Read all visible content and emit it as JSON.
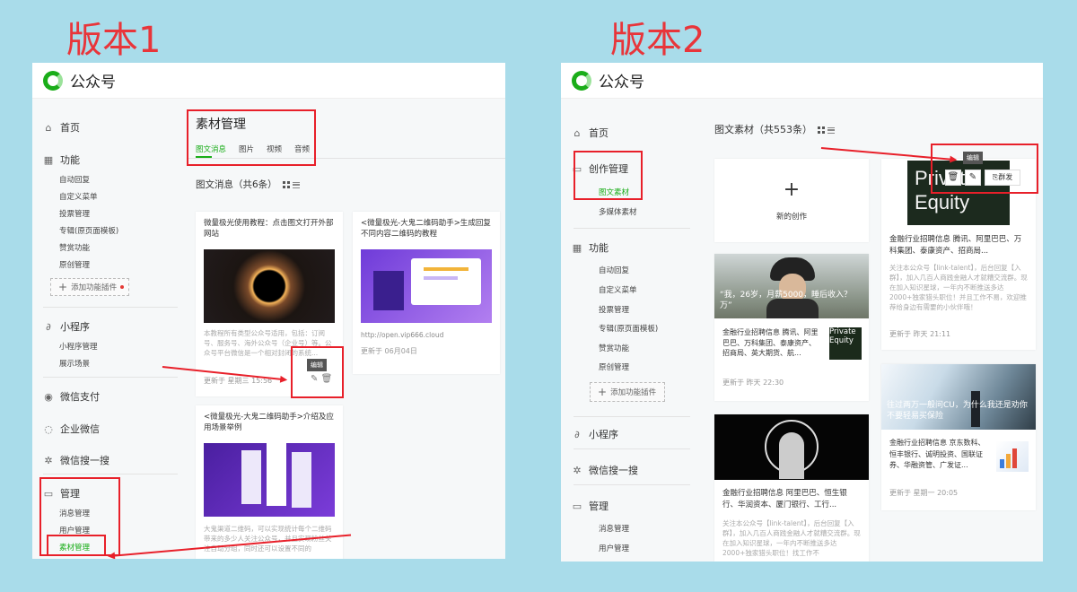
{
  "labels": {
    "v1": "版本1",
    "v2": "版本2"
  },
  "colors": {
    "accent": "#1aad19",
    "highlight": "#e8202a",
    "page_bg": "#a9dcea"
  },
  "v1": {
    "brand": "公众号",
    "nav": {
      "home": "首页",
      "features": "功能",
      "auto_reply": "自动回复",
      "custom_menu": "自定义菜单",
      "vote": "投票管理",
      "special": "专辑(原页面模板)",
      "reward": "赞赏功能",
      "original": "原创管理",
      "add_plugin": "添加功能插件",
      "mini": "小程序",
      "mini_manage": "小程序管理",
      "showcase": "展示场景",
      "pay": "微信支付",
      "work": "企业微信",
      "search": "微信搜一搜",
      "manage": "管理",
      "msg": "消息管理",
      "user": "用户管理",
      "material": "素材管理"
    },
    "header": {
      "title": "素材管理",
      "tabs": [
        "图文消息",
        "图片",
        "视频",
        "音频"
      ]
    },
    "count": "图文消息（共6条）",
    "cards": [
      {
        "title": "微量极光使用教程：点击图文打开外部网站",
        "desc": "本教程所有类型公众号适用，包括：订阅号、服务号、海外公众号（企业号）等。公众号平台微信是一个相对封闭的系统...",
        "updated": "更新于 星期三 15:56"
      },
      {
        "title": "<微量极光-大鬼二维码助手>生成回复不同内容二维码的教程",
        "url": "http://open.vip666.cloud",
        "updated": "更新于 06月04日"
      },
      {
        "title": "<微量极光-大鬼二维码助手>介绍及应用场景举例",
        "desc": "大鬼渠道二维码，可以实现统计每个二维码带来的多少人关注公众号，并且实现粉丝关注自动分组，同时还可以设置不同的"
      }
    ],
    "tooltip": "编辑",
    "icons": [
      "edit-icon",
      "delete-icon"
    ]
  },
  "v2": {
    "brand": "公众号",
    "nav": {
      "home": "首页",
      "create": "创作管理",
      "article": "图文素材",
      "media": "多媒体素材",
      "features": "功能",
      "auto_reply": "自动回复",
      "custom_menu": "自定义菜单",
      "vote": "投票管理",
      "special": "专辑(原页面模板)",
      "reward": "赞赏功能",
      "original": "原创管理",
      "add_plugin": "添加功能插件",
      "mini": "小程序",
      "search": "微信搜一搜",
      "manage": "管理",
      "msg": "消息管理",
      "user": "用户管理"
    },
    "count": "图文素材（共553条）",
    "new_create": "新的创作",
    "tooltip": "编辑",
    "publish": "群发",
    "cards": [
      {
        "overlay": "“我，26岁，月薪5000，睡后收入？万”",
        "sub": "金融行业招聘信息 腾讯、阿里巴巴、万科集团、泰康资产、招商局、英大期货、航...",
        "updated": "更新于 昨天 22:30"
      },
      {
        "title": "金融行业招聘信息 阿里巴巴、恒生银行、华润资本、厦门银行、工行...",
        "desc": "关注本公众号【link-talent】，后台回复【入群】，加入几百人商践金融人才就糟交流群。现在加入知识星球，一年内不断推送多达2000+独家猎头职位！找工作不"
      },
      {
        "img_text": "Private Equity",
        "title": "金融行业招聘信息 腾讯、阿里巴巴、万科集团、泰康资产、招商局...",
        "desc": "关注本公众号【link-talent】，后台回复【入群】，加入几百人商践金融人才就糟交流群。现在加入知识星球，一年内不断推送多达2000+独家猎头职位！并且工作不易，欢迎推荐给身边有需要的小伙伴哦！",
        "updated": "更新于 昨天 21:11",
        "thumb_text": "Private Equity"
      },
      {
        "overlay": "往过两万一般问CU，为什么我还是劝你不要轻易买保险",
        "sub": "金融行业招聘信息 京东数科、恒丰银行、诚明投资、国联证券、华融资管、广发证...",
        "updated": "更新于 星期一 20:05"
      }
    ]
  }
}
